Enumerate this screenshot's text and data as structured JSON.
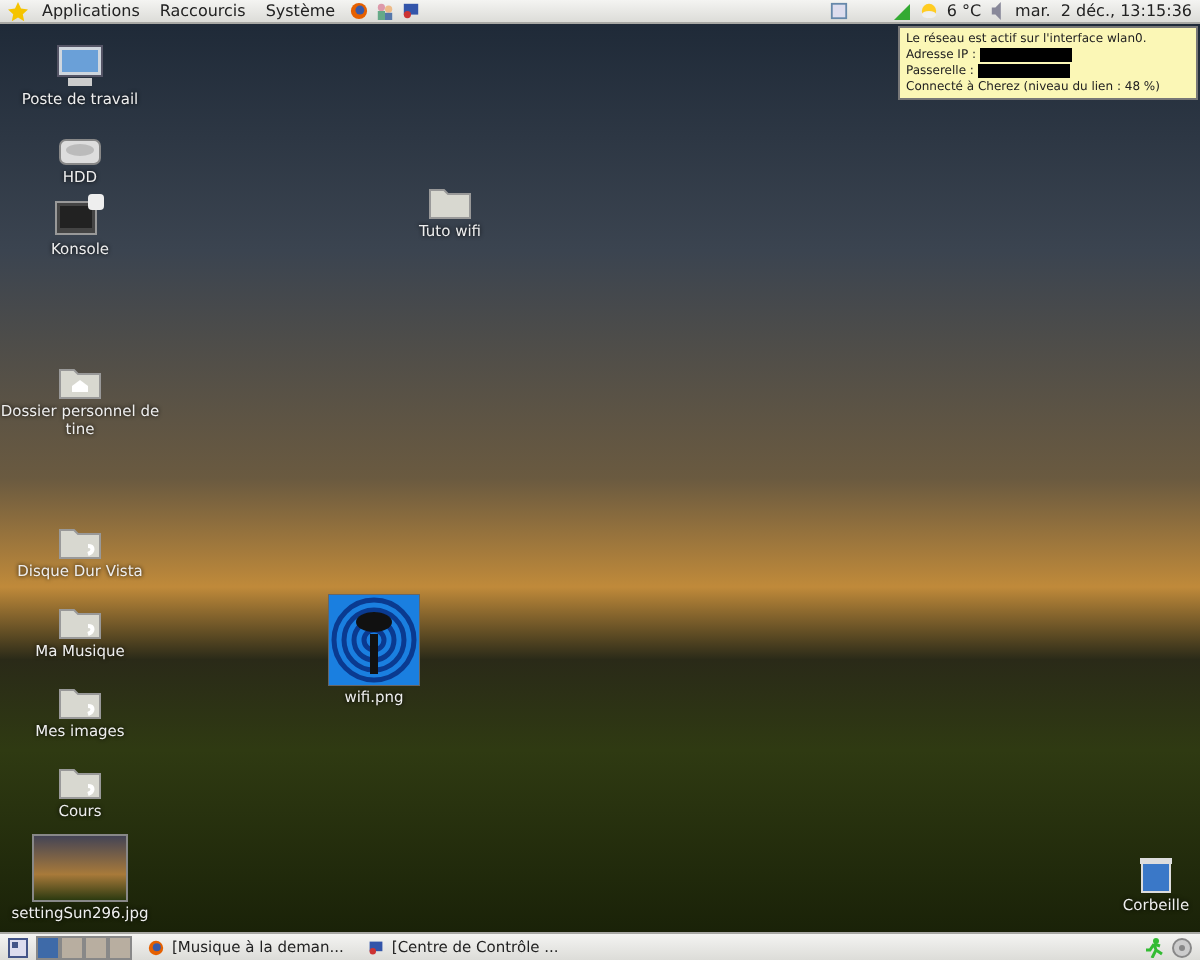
{
  "top_panel": {
    "menus": [
      {
        "label": "Applications"
      },
      {
        "label": "Raccourcis"
      },
      {
        "label": "Système"
      }
    ],
    "temperature": "6 °C",
    "clock": "mar.  2 déc., 13:15:36"
  },
  "tooltip": {
    "lines": [
      {
        "kind": "text",
        "label": "Le réseau est actif sur l'interface wlan0."
      },
      {
        "kind": "redacted",
        "label": "Adresse IP :"
      },
      {
        "kind": "redacted",
        "label": "Passerelle :"
      },
      {
        "kind": "text",
        "label": "Connecté à Cherez (niveau du lien : 48 %)"
      }
    ]
  },
  "desktop_icons": [
    {
      "label": "Poste de travail",
      "kind": "computer"
    },
    {
      "label": "HDD",
      "kind": "drive"
    },
    {
      "label": "Konsole",
      "kind": "terminal"
    },
    {
      "label": "Tuto wifi",
      "kind": "folder"
    },
    {
      "label": "Dossier personnel de tine",
      "kind": "home"
    },
    {
      "label": "Disque Dur Vista",
      "kind": "link-folder"
    },
    {
      "label": "Ma Musique",
      "kind": "link-folder"
    },
    {
      "label": "Mes images",
      "kind": "link-folder"
    },
    {
      "label": "Cours",
      "kind": "link-folder"
    },
    {
      "label": "settingSun296.jpg",
      "kind": "photo"
    },
    {
      "label": "wifi.png",
      "kind": "wifi-image"
    },
    {
      "label": "Corbeille",
      "kind": "trash"
    }
  ],
  "bottom_panel": {
    "workspaces": [
      {
        "selected": true
      },
      {
        "selected": false
      },
      {
        "selected": false
      },
      {
        "selected": false
      }
    ],
    "tasks": [
      {
        "label": "[Musique à la deman...",
        "kind": "firefox"
      },
      {
        "label": "[Centre de Contrôle ...",
        "kind": "control"
      }
    ]
  }
}
